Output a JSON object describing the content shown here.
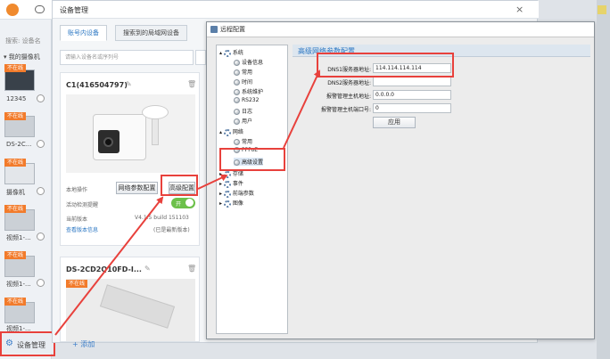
{
  "sidebar": {
    "search_placeholder": "搜索: 设备名",
    "group_label": "我的摄像机",
    "items": [
      {
        "badge": "不在线",
        "label": "12345"
      },
      {
        "badge": "不在线",
        "label": "DS-2C..."
      },
      {
        "badge": "不在线",
        "label": "摄像机"
      },
      {
        "badge": "不在线",
        "label": "视频1-..."
      },
      {
        "badge": "不在线",
        "label": "视频1-..."
      },
      {
        "badge": "不在线",
        "label": "视频1-..."
      }
    ],
    "device_manager_label": "设备管理"
  },
  "devmgr": {
    "title": "设备管理",
    "tabs": [
      "账号内设备",
      "搜索到的局域网设备"
    ],
    "search_placeholder": "请输入设备名或序列号",
    "card1": {
      "name": "C1(416504797)",
      "local_op_label": "本地操作",
      "network_btn": "网络参数配置",
      "advanced_btn": "高级配置",
      "motion_label": "活动检测提醒",
      "toggle_on": "开",
      "version_label": "当前版本",
      "version_value": "V4.1.5 build 151103",
      "check_link": "查看版本信息",
      "latest_text": "(已是最新版本)"
    },
    "card2": {
      "name": "DS-2CD2Q10FD-I...",
      "badge": "不在线"
    },
    "add_label": "添加"
  },
  "cfg": {
    "title": "远程配置",
    "section_title": "高级网络参数配置",
    "tree": {
      "system": "系统",
      "system_children": [
        "设备信息",
        "常用",
        "时间",
        "系统维护",
        "RS232",
        "日志",
        "用户"
      ],
      "network": "网络",
      "network_children": [
        "常用",
        "PPPoE",
        "高级设置"
      ],
      "others": [
        "存储",
        "事件",
        "前端参数",
        "图像"
      ]
    },
    "fields": [
      {
        "label": "DNS1服务器地址:",
        "value": "114.114.114.114"
      },
      {
        "label": "DNS2服务器地址:",
        "value": ""
      },
      {
        "label": "报警管理主机地址:",
        "value": "0.0.0.0"
      },
      {
        "label": "报警管理主机端口号:",
        "value": "0"
      }
    ],
    "apply_label": "应用"
  },
  "colors": {
    "highlight": "#e8413c",
    "offline_badge": "#f27b2b",
    "link": "#2b77c3",
    "toggle": "#6cc04a"
  }
}
